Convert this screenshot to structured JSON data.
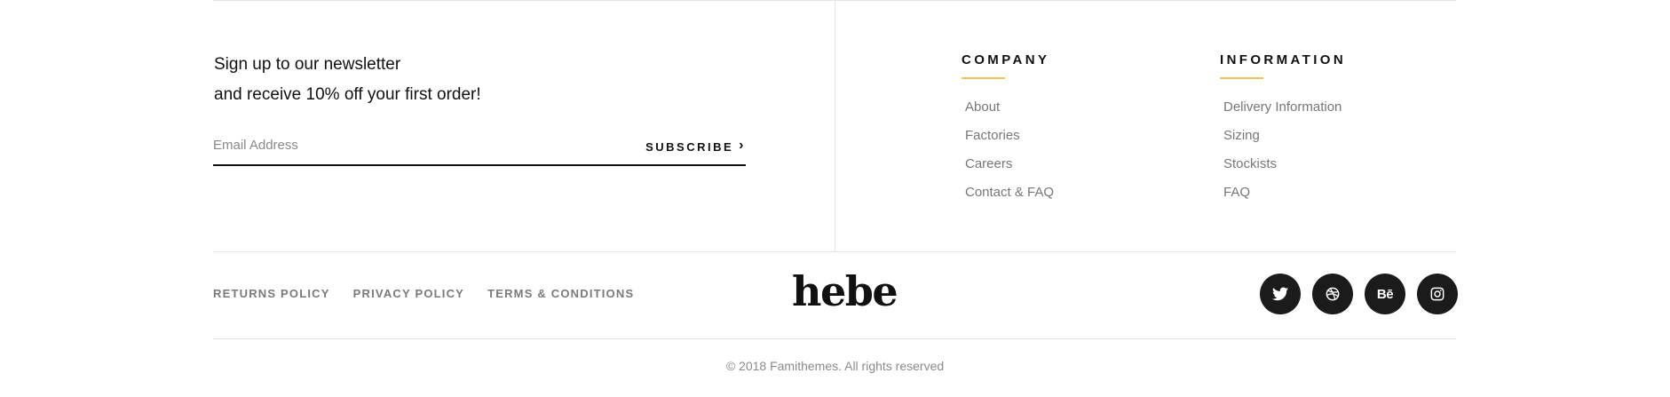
{
  "newsletter": {
    "line1": "Sign up to our newsletter",
    "line2": "and receive 10% off your first order!",
    "email_placeholder": "Email Address",
    "subscribe_label": "SUBSCRIBE"
  },
  "company": {
    "title": "COMPANY",
    "links": [
      "About",
      "Factories",
      "Careers",
      "Contact & FAQ"
    ]
  },
  "information": {
    "title": "INFORMATION",
    "links": [
      "Delivery Information",
      "Sizing",
      "Stockists",
      "FAQ"
    ]
  },
  "legal": [
    "RETURNS POLICY",
    "PRIVACY POLICY",
    "TERMS & CONDITIONS"
  ],
  "logo": "hebe",
  "social": [
    {
      "icon": "twitter-icon"
    },
    {
      "icon": "dribbble-icon"
    },
    {
      "icon": "behance-icon",
      "text": "Bē"
    },
    {
      "icon": "instagram-icon"
    }
  ],
  "copyright": "© 2018 Famithemes. All rights reserved",
  "colors": {
    "accent_underline": "#f0c15c",
    "social_bg": "#1b1b1b",
    "muted_text": "#777777"
  }
}
